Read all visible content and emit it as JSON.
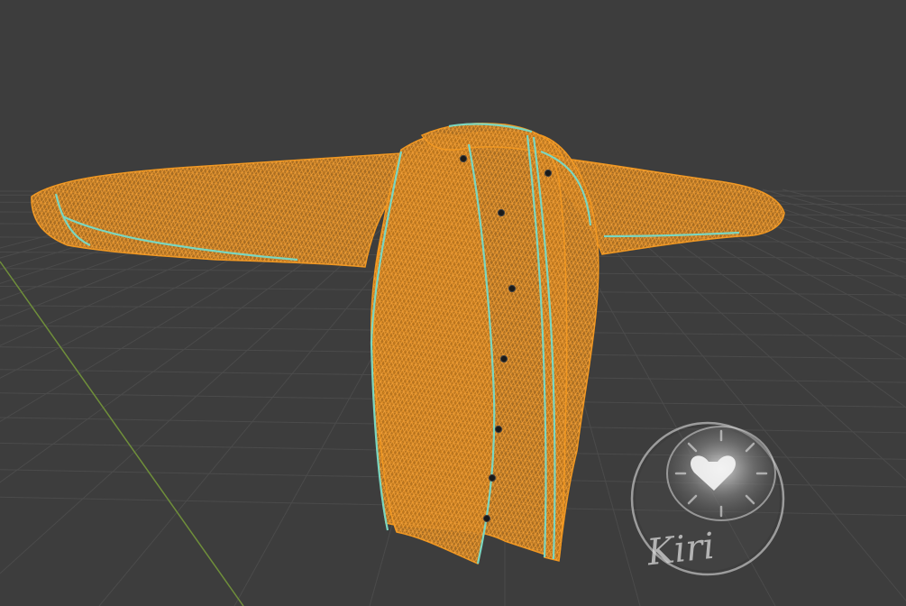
{
  "viewport": {
    "background_color": "#3d3d3d",
    "grid_color": "#4b4b4b",
    "axis_y_color": "#6f8f3a"
  },
  "model": {
    "wire_color": "#f0961e",
    "fill_color": "#b8741e",
    "seam_color": "#7ad6c0",
    "button_color": "#1a1a1a",
    "button_count": 8
  },
  "watermark": {
    "icon": "kiri-fruit-logo-icon",
    "text": "Kiri"
  }
}
